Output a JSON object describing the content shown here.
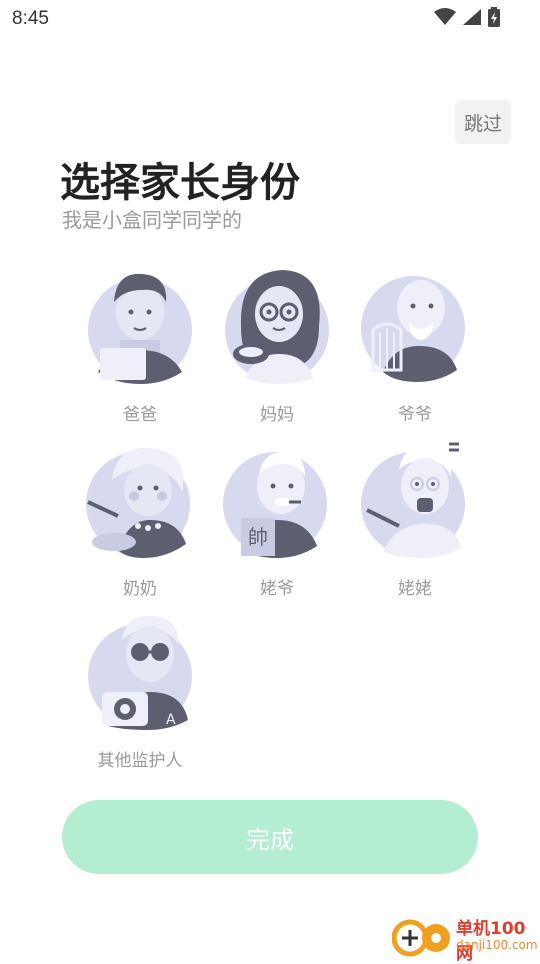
{
  "status_bar": {
    "time": "8:45"
  },
  "skip_label": "跳过",
  "title": "选择家长身份",
  "subtitle": "我是小盒同学同学的",
  "roles": [
    {
      "label": "爸爸",
      "avatar": "dad-avatar"
    },
    {
      "label": "妈妈",
      "avatar": "mom-avatar"
    },
    {
      "label": "爷爷",
      "avatar": "paternal-grandpa-avatar"
    },
    {
      "label": "奶奶",
      "avatar": "paternal-grandma-avatar"
    },
    {
      "label": "姥爷",
      "avatar": "maternal-grandpa-avatar"
    },
    {
      "label": "姥姥",
      "avatar": "maternal-grandma-avatar"
    },
    {
      "label": "其他监护人",
      "avatar": "guardian-avatar"
    }
  ],
  "avatar_badge_text": "帥",
  "done_label": "完成",
  "watermark": {
    "title": "单机100网",
    "sub": "danji100.com"
  },
  "colors": {
    "button": "#b4eed2",
    "avatar_bg": "#d7d9ef",
    "avatar_dark": "#5d5f70"
  }
}
